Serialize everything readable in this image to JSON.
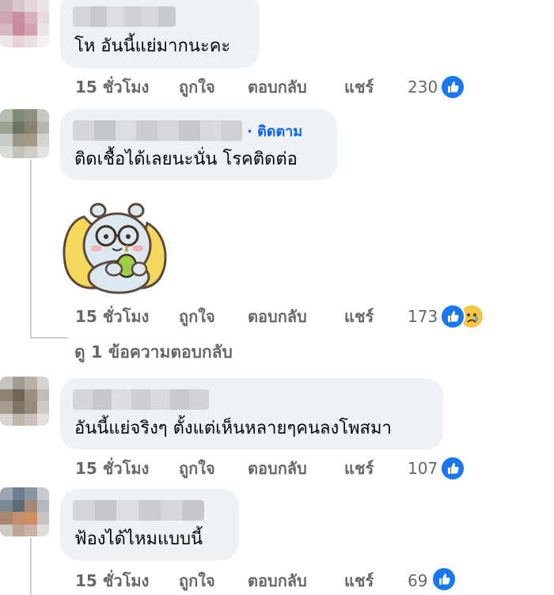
{
  "comments": [
    {
      "text": "โห อันนี้แย่มากนะคะ",
      "time": "15 ชั่วโมง",
      "like_label": "ถูกใจ",
      "reply_label": "ตอบกลับ",
      "share_label": "แชร์",
      "reaction_count": "230",
      "reactions": [
        "like-icon"
      ]
    },
    {
      "follow_label": "· ติดตาม",
      "text": "ติดเชื้อได้เลยนะนั่น โรคติดต่อ",
      "sticker": "bear-sticker",
      "time": "15 ชั่วโมง",
      "like_label": "ถูกใจ",
      "reply_label": "ตอบกลับ",
      "share_label": "แชร์",
      "reaction_count": "173",
      "reactions": [
        "like-icon",
        "sad-icon"
      ],
      "view_replies": "ดู 1 ข้อความตอบกลับ"
    },
    {
      "text": "อันนี้แย่จริงๆ ตั้งแต่เห็นหลายๆคนลงโพสมา",
      "time": "15 ชั่วโมง",
      "like_label": "ถูกใจ",
      "reply_label": "ตอบกลับ",
      "share_label": "แชร์",
      "reaction_count": "107",
      "reactions": [
        "like-icon"
      ]
    },
    {
      "text": "ฟ้องได้ไหมแบบนี้",
      "time": "15 ชั่วโมง",
      "like_label": "ถูกใจ",
      "reply_label": "ตอบกลับ",
      "share_label": "แชร์",
      "reaction_count": "69",
      "reactions": [
        "like-icon"
      ]
    }
  ],
  "colors": {
    "bubble": "#eff2f5",
    "meta_text": "#65676b",
    "like_blue": "#1877f2",
    "follow_blue": "#0866ff"
  }
}
